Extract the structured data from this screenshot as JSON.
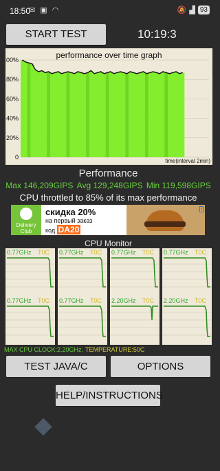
{
  "status_bar": {
    "time": "18:50",
    "battery": "93"
  },
  "buttons": {
    "start_test": "START TEST",
    "test_java_c": "TEST JAVA/C",
    "options": "OPTIONS",
    "help": "HELP/INSTRUCTIONS"
  },
  "elapsed_clock": "10:19:3",
  "graph": {
    "title": "performance over time graph",
    "y_ticks": [
      "100%",
      "80%",
      "60%",
      "40%",
      "20%",
      "0"
    ],
    "x_label": "time(interval 2min)"
  },
  "chart_data": {
    "type": "line",
    "title": "performance over time graph",
    "xlabel": "time(interval 2min)",
    "ylabel": "",
    "ylim": [
      0,
      100
    ],
    "y_ticks": [
      "100%",
      "80%",
      "60%",
      "40%",
      "20%",
      "0"
    ],
    "series": [
      {
        "values": [
          100,
          98,
          97,
          96,
          90,
          88,
          89,
          87,
          88,
          86,
          87,
          88,
          86,
          87,
          88,
          87,
          86,
          88,
          87,
          86,
          87,
          89,
          86,
          87,
          88,
          86,
          87,
          88,
          86,
          87,
          88,
          87,
          86,
          88,
          87,
          86,
          87,
          88,
          86,
          87,
          88,
          87,
          86,
          88,
          87,
          86,
          87,
          88,
          86,
          87
        ]
      }
    ]
  },
  "performance": {
    "title": "Performance",
    "max": "Max 146,209GIPS",
    "avg": "Avg 129,248GIPS",
    "min": "Min 119,598GIPS",
    "throttle_text": "CPU throttled to 85% of its max performance"
  },
  "ad": {
    "brand": "Delivery Club",
    "line1": "скидка 20%",
    "line2": "на первый заказ",
    "code_prefix": "код",
    "code": "DA20"
  },
  "cpu_monitor": {
    "title": "CPU Monitor",
    "cores": [
      {
        "freq": "0.77GHz",
        "temp": "T0C"
      },
      {
        "freq": "0.77GHz",
        "temp": "T0C"
      },
      {
        "freq": "0.77GHz",
        "temp": "T0C"
      },
      {
        "freq": "0.77GHz",
        "temp": "T0C"
      },
      {
        "freq": "0.77GHz",
        "temp": "T0C"
      },
      {
        "freq": "0.77GHz",
        "temp": "T0C"
      },
      {
        "freq": "2.20GHz",
        "temp": "T0C"
      },
      {
        "freq": "2.20GHz",
        "temp": "T0C"
      }
    ],
    "max_clock": "MAX CPU CLOCK:2.20GHz,",
    "temperature": "TEMPERATURE:50C"
  },
  "colors": {
    "graph_bg": "#eee9d8",
    "bar_green": "#7ee82a",
    "line": "#111111",
    "stat_green": "#6ad13f"
  }
}
